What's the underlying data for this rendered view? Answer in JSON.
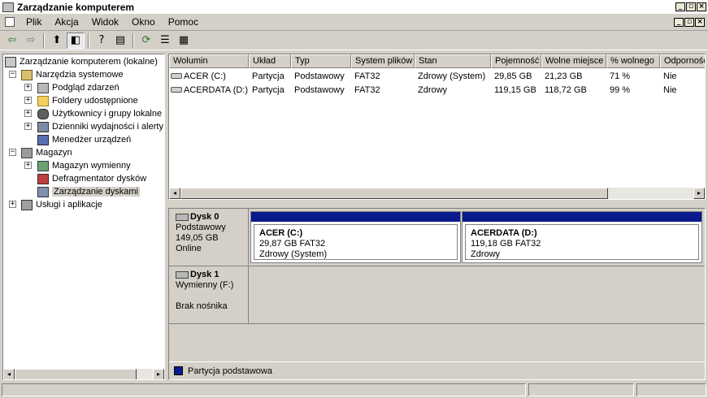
{
  "window": {
    "title": "Zarządzanie komputerem"
  },
  "menu": {
    "items": [
      "Plik",
      "Akcja",
      "Widok",
      "Okno",
      "Pomoc"
    ]
  },
  "window_buttons": {
    "minimize": "_",
    "restore": "▫",
    "close": "×"
  },
  "toolbar": {
    "back_icon": "⇦",
    "forward_icon": "⇨",
    "up_icon": "⬆",
    "tree_icon": "◧",
    "help_icon": "?",
    "view_icon": "▤",
    "refresh_icon": "⟳",
    "properties_icon": "☰",
    "export_icon": "▦"
  },
  "tree": {
    "root": "Zarządzanie komputerem (lokalne)",
    "system_tools": "Narzędzia systemowe",
    "event_viewer": "Podgląd zdarzeń",
    "shared_folders": "Foldery udostępnione",
    "users_groups": "Użytkownicy i grupy lokalne",
    "perf_logs": "Dzienniki wydajności i alerty",
    "device_manager": "Menedżer urządzeń",
    "storage": "Magazyn",
    "removable_storage": "Magazyn wymienny",
    "defrag": "Defragmentator dysków",
    "disk_management": "Zarządzanie dyskami",
    "services": "Usługi i aplikacje",
    "expand_plus": "+",
    "expand_minus": "−"
  },
  "volume_list": {
    "columns": [
      "Wolumin",
      "Układ",
      "Typ",
      "System plików",
      "Stan",
      "Pojemność",
      "Wolne miejsce",
      "% wolnego",
      "Odporność"
    ],
    "rows": [
      [
        "ACER (C:)",
        "Partycja",
        "Podstawowy",
        "FAT32",
        "Zdrowy (System)",
        "29,85 GB",
        "21,23 GB",
        "71 %",
        "Nie"
      ],
      [
        "ACERDATA (D:)",
        "Partycja",
        "Podstawowy",
        "FAT32",
        "Zdrowy",
        "119,15 GB",
        "118,72 GB",
        "99 %",
        "Nie"
      ]
    ]
  },
  "disks": {
    "disk0": {
      "name": "Dysk 0",
      "type": "Podstawowy",
      "size": "149,05 GB",
      "status": "Online",
      "partitions": [
        {
          "title": "ACER  (C:)",
          "detail": "29,87 GB FAT32",
          "status": "Zdrowy (System)"
        },
        {
          "title": "ACERDATA  (D:)",
          "detail": "119,18 GB FAT32",
          "status": "Zdrowy"
        }
      ]
    },
    "disk1": {
      "name": "Dysk 1",
      "type": "Wymienny (F:)",
      "status": "Brak nośnika"
    }
  },
  "legend": {
    "primary_partition": "Partycja podstawowa",
    "primary_color": "#0a1a8c"
  },
  "scroll": {
    "left": "◂",
    "right": "▸"
  }
}
